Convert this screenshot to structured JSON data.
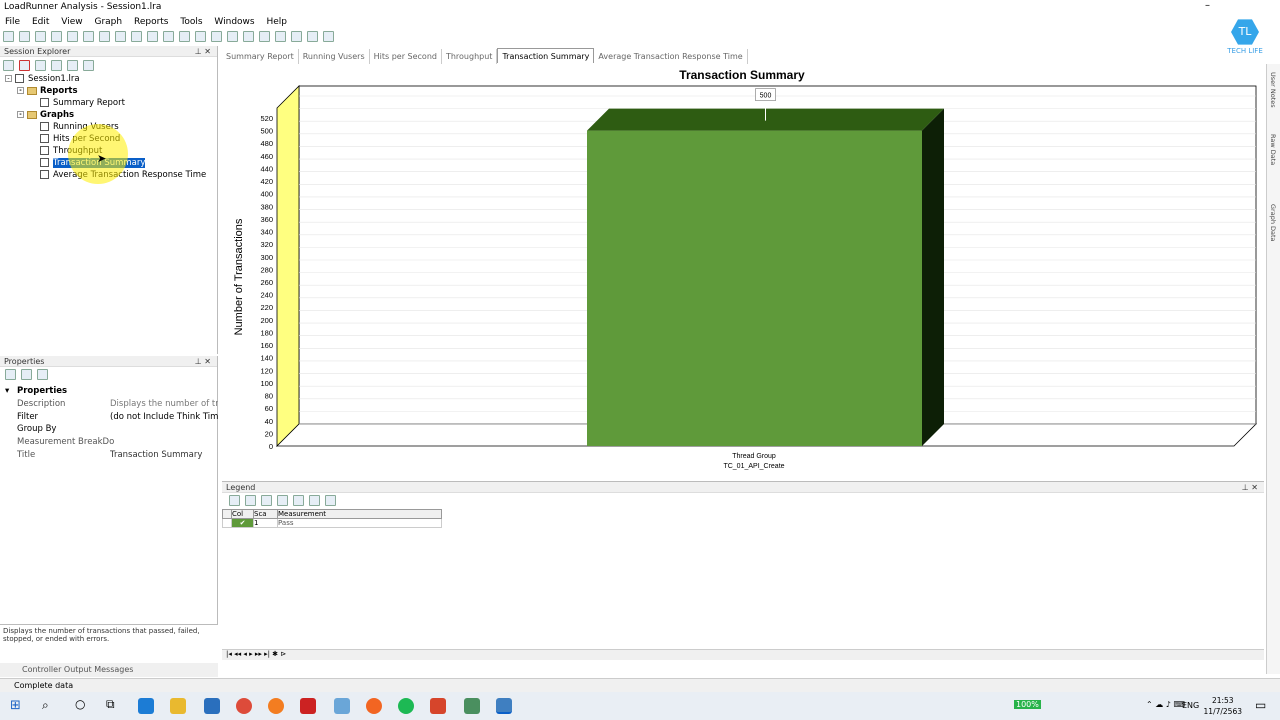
{
  "window": {
    "title": "LoadRunner Analysis - Session1.lra"
  },
  "menu": [
    "File",
    "Edit",
    "View",
    "Graph",
    "Reports",
    "Tools",
    "Windows",
    "Help"
  ],
  "session_explorer": {
    "title": "Session Explorer",
    "root": "Session1.lra",
    "reports_label": "Reports",
    "summary_report": "Summary Report",
    "graphs_label": "Graphs",
    "graphs": [
      "Running Vusers",
      "Hits per Second",
      "Throughput",
      "Transaction Summary",
      "Average Transaction Response Time"
    ]
  },
  "properties": {
    "title": "Properties",
    "section": "Properties",
    "rows": [
      {
        "key": "Description",
        "value": "Displays the number of tran"
      },
      {
        "key": "Filter",
        "value": "(do not Include Think Time)"
      },
      {
        "key": "Group By",
        "value": ""
      },
      {
        "key": "Measurement BreakDo",
        "value": ""
      },
      {
        "key": "Title",
        "value": "Transaction Summary"
      }
    ],
    "description": "Displays the number of transactions that passed, failed, stopped, or ended with errors."
  },
  "controller_output": "Controller Output Messages",
  "status_bar": "Complete data",
  "tabs": [
    "Summary Report",
    "Running Vusers",
    "Hits per Second",
    "Throughput",
    "Transaction Summary",
    "Average Transaction Response Time"
  ],
  "active_tab": "Transaction Summary",
  "chart_data": {
    "type": "bar",
    "title": "Transaction Summary",
    "xlabel": "",
    "ylabel": "Number of Transactions",
    "categories": [
      "Thread Group"
    ],
    "category_sublabel": "TC_01_API_Create",
    "series": [
      {
        "name": "Pass",
        "values": [
          500
        ],
        "color": "#5f9a3a"
      }
    ],
    "data_labels": [
      "500"
    ],
    "ylim": [
      0,
      520
    ],
    "yticks": [
      0,
      20,
      40,
      60,
      80,
      100,
      120,
      140,
      160,
      180,
      200,
      220,
      240,
      260,
      280,
      300,
      320,
      340,
      360,
      380,
      400,
      420,
      440,
      460,
      480,
      500,
      520
    ],
    "grid": true
  },
  "legend": {
    "title": "Legend",
    "columns": [
      "Col",
      "Sca",
      "Measurement"
    ],
    "rows": [
      {
        "scale": "1",
        "measurement": "Pass",
        "color": "#5f9a3a"
      }
    ]
  },
  "right_tabs": [
    "User Notes",
    "Raw Data",
    "Graph Data"
  ],
  "logo": {
    "initials": "TL",
    "text": "TECH LIFE"
  },
  "taskbar": {
    "zoom": "100%",
    "lang": "ENG",
    "time": "21:53",
    "date": "11/7/2563"
  }
}
